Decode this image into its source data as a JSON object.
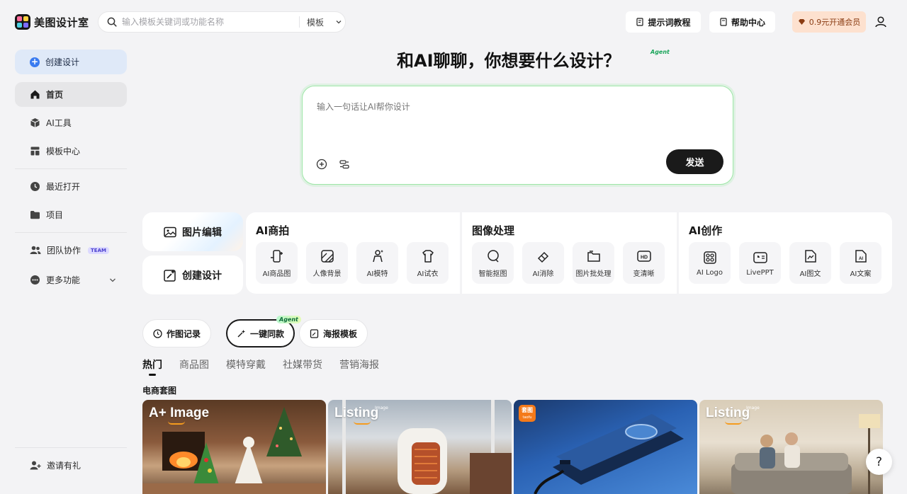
{
  "app": {
    "name": "美图设计室"
  },
  "search": {
    "placeholder": "输入模板关键词或功能名称",
    "scope": "模板"
  },
  "header": {
    "prompt_tutorial": "提示词教程",
    "help_center": "帮助中心",
    "vip": "0.9元开通会员"
  },
  "sidebar": {
    "create": "创建设计",
    "items": [
      "首页",
      "AI工具",
      "模板中心",
      "最近打开",
      "项目",
      "团队协作",
      "更多功能"
    ],
    "team_badge": "TEAM",
    "invite": "邀请有礼"
  },
  "hero": {
    "title": "和AI聊聊，你想要什么设计？",
    "agent": "Agent",
    "input_placeholder": "输入一句话让AI帮你设计",
    "send": "发送"
  },
  "quick": {
    "edit": "图片编辑",
    "create": "创建设计"
  },
  "panels": [
    {
      "title": "AI商拍",
      "tools": [
        "AI商品图",
        "人像背景",
        "AI模特",
        "AI试衣"
      ]
    },
    {
      "title": "图像处理",
      "tools": [
        "智能抠图",
        "AI消除",
        "图片批处理",
        "变清晰"
      ]
    },
    {
      "title": "AI创作",
      "tools": [
        "AI Logo",
        "LivePPT",
        "AI图文",
        "AI文案"
      ]
    }
  ],
  "chips": {
    "history": "作图记录",
    "same": "一键同款",
    "agent": "Agent",
    "poster": "海报模板"
  },
  "categories": [
    "热门",
    "商品图",
    "模特穿戴",
    "社媒带货",
    "营销海报"
  ],
  "section": {
    "title": "电商套图"
  },
  "cards": [
    {
      "label": "A+ Image"
    },
    {
      "label": "Listing",
      "sub": "Image"
    },
    {
      "label": "",
      "badge": "套图",
      "badge_sub": "taofu"
    },
    {
      "label": "Listing",
      "sub": "Image"
    }
  ],
  "help": "?"
}
